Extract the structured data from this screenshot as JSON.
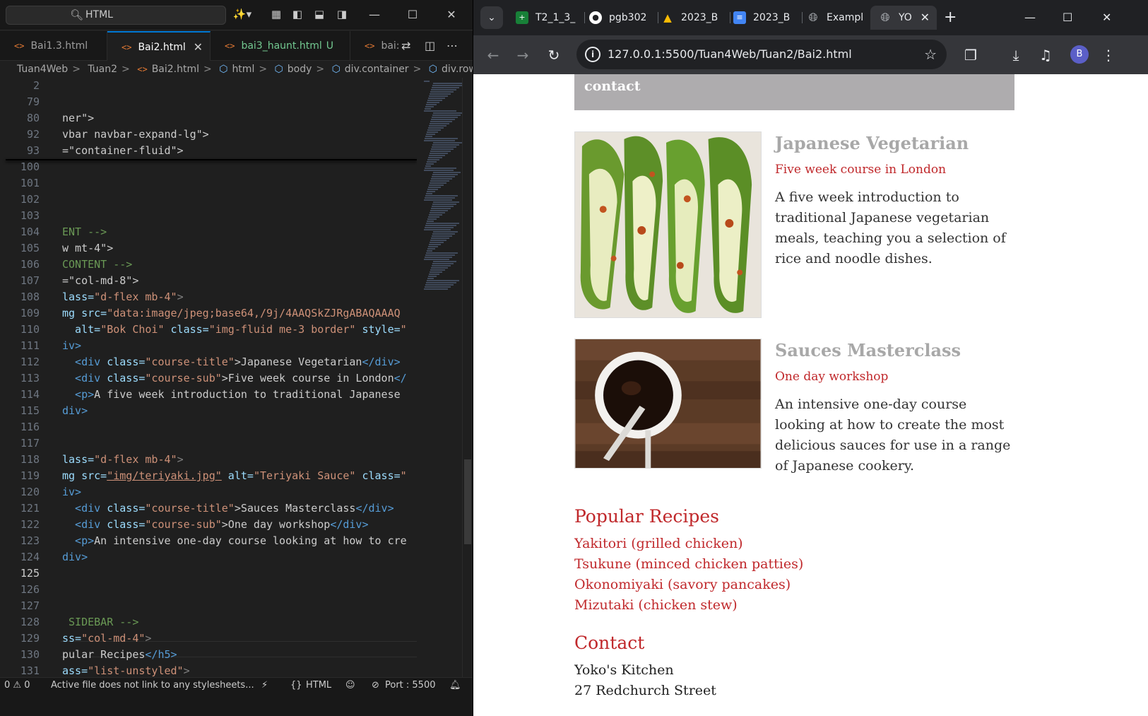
{
  "vscode": {
    "search_text": "HTML",
    "tabs": [
      {
        "label": "Bai1.3.html",
        "modifier": ""
      },
      {
        "label": "Bai2.html",
        "modifier": ""
      },
      {
        "label": "bai3_haunt.html",
        "modifier": "U"
      },
      {
        "label": "bai:",
        "modifier": ""
      }
    ],
    "breadcrumb": [
      "Tuan4Web",
      "Tuan2",
      "Bai2.html",
      "html",
      "body",
      "div.container",
      "div.row.mt"
    ],
    "line_numbers": [
      "2",
      "79",
      "80",
      "92",
      "93",
      "100",
      "101",
      "102",
      "103",
      "104",
      "105",
      "106",
      "107",
      "108",
      "109",
      "110",
      "111",
      "112",
      "113",
      "114",
      "115",
      "116",
      "117",
      "118",
      "119",
      "120",
      "121",
      "122",
      "123",
      "124",
      "125",
      "126",
      "127",
      "128",
      "129",
      "130",
      "131"
    ],
    "code": {
      "l80": "ner\">",
      "l92": "vbar navbar-expand-lg\">",
      "l93": "=\"container-fluid\">",
      "l104": "ENT -->",
      "l105": "w mt-4\">",
      "l106": "CONTENT -->",
      "l107": "=\"col-md-8\">",
      "l108a": "lass=",
      "l108b": "\"d-flex mb-4\"",
      "l108c": ">",
      "l109a": "mg src=",
      "l109b": "\"data:image/jpeg;base64,/9j/4AAQSkZJRgABAQAAAQ",
      "l110a": "  alt=",
      "l110b": "\"Bok Choi\"",
      "l110c": " class=",
      "l110d": "\"img-fluid me-3 border\"",
      "l110e": " style=",
      "l110f": "\"",
      "l111": "iv>",
      "l112a": "  <div ",
      "l112b": "class=",
      "l112c": "\"course-title\"",
      "l112d": ">Japanese Vegetarian",
      "l112e": "</div>",
      "l113a": "  <div ",
      "l113b": "class=",
      "l113c": "\"course-sub\"",
      "l113d": ">Five week course in London",
      "l113e": "</",
      "l114a": "  <p>",
      "l114b": "A five week introduction to traditional Japanese",
      "l115": "div>",
      "l118a": "lass=",
      "l118b": "\"d-flex mb-4\"",
      "l118c": ">",
      "l119a": "mg src=",
      "l119b": "\"img/teriyaki.jpg\"",
      "l119c": " alt=",
      "l119d": "\"Teriyaki Sauce\"",
      "l119e": " class=",
      "l119f": "\"",
      "l120": "iv>",
      "l121a": "  <div ",
      "l121b": "class=",
      "l121c": "\"course-title\"",
      "l121d": ">Sauces Masterclass",
      "l121e": "</div>",
      "l122a": "  <div ",
      "l122b": "class=",
      "l122c": "\"course-sub\"",
      "l122d": ">One day workshop",
      "l122e": "</div>",
      "l123a": "  <p>",
      "l123b": "An intensive one-day course looking at how to cre",
      "l124": "div>",
      "l128": " SIDEBAR -->",
      "l129a": "ss=",
      "l129b": "\"col-md-4\"",
      "l129c": ">",
      "l130a": "pular Recipes",
      "l130b": "</h5>",
      "l131a": "ass=",
      "l131b": "\"list-unstyled\"",
      "l131c": ">"
    },
    "status": {
      "problems": "0 ⚠ 0",
      "message": "Active file does not link to any stylesheets...",
      "language": "HTML",
      "port": "Port : 5500"
    }
  },
  "chrome": {
    "tabs": [
      "T2_1_3_",
      "pgb302",
      "2023_B",
      "2023_B",
      "Exampl",
      "YO"
    ],
    "url": "127.0.0.1:5500/Tuan4Web/Tuan2/Bai2.html",
    "avatar_letter": "B"
  },
  "page": {
    "contact_nav": "contact",
    "courses": [
      {
        "title": "Japanese Vegetarian",
        "subtitle": "Five week course in London",
        "description": "A five week introduction to traditional Japanese vegetarian meals, teaching you a selection of rice and noodle dishes.",
        "image_alt": "Bok Choi"
      },
      {
        "title": "Sauces Masterclass",
        "subtitle": "One day workshop",
        "description": "An intensive one-day course looking at how to create the most delicious sauces for use in a range of Japanese cookery.",
        "image_alt": "Teriyaki Sauce"
      }
    ],
    "popular_heading": "Popular Recipes",
    "recipes": [
      "Yakitori (grilled chicken)",
      "Tsukune (minced chicken patties)",
      "Okonomiyaki (savory pancakes)",
      "Mizutaki (chicken stew)"
    ],
    "contact_heading": "Contact",
    "contact_lines": [
      "Yoko's Kitchen",
      "27 Redchurch Street"
    ]
  },
  "colors": {
    "accent_red": "#c0282b",
    "course_title_gray": "#a8a8a8",
    "nav_bar_gray": "#aeacae",
    "vscode_accent": "#0078d4"
  }
}
